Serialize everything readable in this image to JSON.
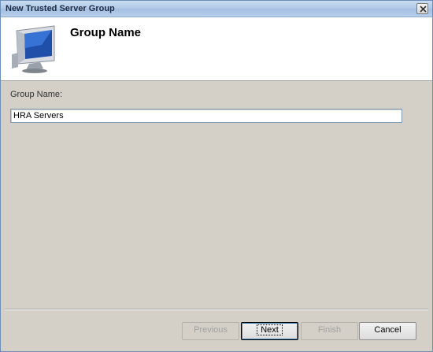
{
  "window": {
    "title": "New Trusted Server Group"
  },
  "header": {
    "title": "Group Name",
    "icon": "computer-icon"
  },
  "form": {
    "label": "Group Name:",
    "value": "HRA Servers"
  },
  "buttons": {
    "previous": "Previous",
    "next": "Next",
    "finish": "Finish",
    "cancel": "Cancel"
  }
}
